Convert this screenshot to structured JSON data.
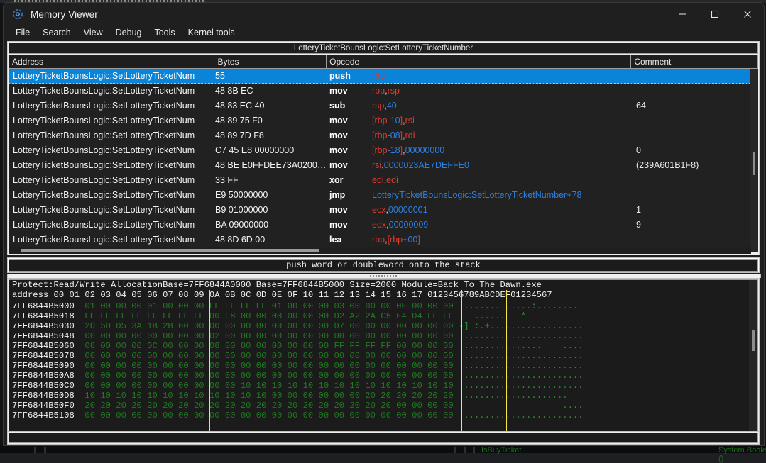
{
  "window": {
    "title": "Memory Viewer",
    "icon": "cheat-engine-icon",
    "controls": {
      "minimize": "—",
      "maximize": "☐",
      "close": "✕"
    }
  },
  "menubar": {
    "items": [
      "File",
      "Search",
      "View",
      "Debug",
      "Tools",
      "Kernel tools"
    ]
  },
  "disassembler": {
    "function_header": "LotteryTicketBounsLogic:SetLotteryTicketNumber",
    "columns": [
      "Address",
      "Bytes",
      "Opcode",
      "Comment"
    ],
    "rows": [
      {
        "address": "LotteryTicketBounsLogic:SetLotteryTicketNum",
        "bytes": "55",
        "mnemonic": "push",
        "operands": "rbp",
        "comment": "",
        "selected": true
      },
      {
        "address": "LotteryTicketBounsLogic:SetLotteryTicketNum",
        "bytes": "48 8B EC",
        "mnemonic": "mov",
        "operands": "rbp,rsp",
        "comment": "",
        "selected": false
      },
      {
        "address": "LotteryTicketBounsLogic:SetLotteryTicketNum",
        "bytes": "48 83 EC 40",
        "mnemonic": "sub",
        "operands": "rsp,40",
        "comment": "64",
        "selected": false
      },
      {
        "address": "LotteryTicketBounsLogic:SetLotteryTicketNum",
        "bytes": "48 89 75 F0",
        "mnemonic": "mov",
        "operands": "[rbp-10],rsi",
        "comment": "",
        "selected": false
      },
      {
        "address": "LotteryTicketBounsLogic:SetLotteryTicketNum",
        "bytes": "48 89 7D F8",
        "mnemonic": "mov",
        "operands": "[rbp-08],rdi",
        "comment": "",
        "selected": false
      },
      {
        "address": "LotteryTicketBounsLogic:SetLotteryTicketNum",
        "bytes": "C7 45 E8 00000000",
        "mnemonic": "mov",
        "operands": "[rbp-18],00000000",
        "comment": "0",
        "selected": false
      },
      {
        "address": "LotteryTicketBounsLogic:SetLotteryTicketNum",
        "bytes": "48 BE E0FFDEE73A0200…",
        "mnemonic": "mov",
        "operands": "rsi,0000023AE7DEFFE0",
        "comment": "(239A601B1F8)",
        "selected": false
      },
      {
        "address": "LotteryTicketBounsLogic:SetLotteryTicketNum",
        "bytes": "33 FF",
        "mnemonic": "xor",
        "operands": "edi,edi",
        "comment": "",
        "selected": false
      },
      {
        "address": "LotteryTicketBounsLogic:SetLotteryTicketNum",
        "bytes": "E9 50000000",
        "mnemonic": "jmp",
        "operands": "LotteryTicketBounsLogic:SetLotteryTicketNumber+78",
        "comment": "",
        "selected": false
      },
      {
        "address": "LotteryTicketBounsLogic:SetLotteryTicketNum",
        "bytes": "B9 01000000",
        "mnemonic": "mov",
        "operands": "ecx,00000001",
        "comment": "1",
        "selected": false
      },
      {
        "address": "LotteryTicketBounsLogic:SetLotteryTicketNum",
        "bytes": "BA 09000000",
        "mnemonic": "mov",
        "operands": "edx,00000009",
        "comment": "9",
        "selected": false
      },
      {
        "address": "LotteryTicketBounsLogic:SetLotteryTicketNum",
        "bytes": "48 8D 6D 00",
        "mnemonic": "lea",
        "operands": "rbp,[rbp+00]",
        "comment": "",
        "selected": false
      }
    ]
  },
  "hint_bar": {
    "text": "push word or doubleword onto the stack"
  },
  "hexview": {
    "info": "Protect:Read/Write  AllocationBase=7FF6844A0000 Base=7FF6844B5000 Size=2000 Module=Back To The Dawn.exe",
    "column_header": "address      00 01 02 03 04 05 06 07 08 09 0A 0B 0C 0D 0E 0F 10 11 12 13 14 15 16 17 0123456789ABCDEF01234567",
    "rows": [
      {
        "address": "7FF6844B5000",
        "bytes": "01 00 00 00 01 00 00 00 FF FF FF FF 01 00 00 00 03 00 00 00 0E 00 00 00",
        "ascii": "........ .....:........"
      },
      {
        "address": "7FF6844B5018",
        "bytes": "FF FF FF FF FF FF FF FF 00 F8 00 00 00 00 00 00 D2 A2 2A C5 E4 D4 FF FF",
        "ascii": ".  ......   *"
      },
      {
        "address": "7FF6844B5030",
        "bytes": "2D 5D D5 3A 1B 2B 00 00 00 00 00 00 00 00 00 00 07 00 00 00 00 00 00 00",
        "ascii": "-] :.+.................."
      },
      {
        "address": "7FF6844B5048",
        "bytes": "00 00 00 00 00 00 00 00 02 00 00 00 00 00 00 00 00 00 00 00 00 00 00 00",
        "ascii": "........................"
      },
      {
        "address": "7FF6844B5060",
        "bytes": "08 00 00 00 0C 00 00 00 08 00 00 00 00 00 00 00 FF FF FF FF 00 00 00 00",
        "ascii": "................    ...."
      },
      {
        "address": "7FF6844B5078",
        "bytes": "00 00 00 00 00 00 00 00 00 00 00 00 00 00 00 00 00 00 00 00 00 00 00 00",
        "ascii": "........................"
      },
      {
        "address": "7FF6844B5090",
        "bytes": "00 00 00 00 00 00 00 00 00 00 00 00 00 00 00 00 00 00 00 00 00 00 00 00",
        "ascii": "........................"
      },
      {
        "address": "7FF6844B50A8",
        "bytes": "00 00 00 00 00 00 00 00 00 00 00 00 00 00 00 00 00 00 00 00 00 00 00 00",
        "ascii": "........................"
      },
      {
        "address": "7FF6844B50C0",
        "bytes": "00 00 00 00 00 00 00 00 00 00 10 10 10 10 10 10 10 10 10 10 10 10 10 10",
        "ascii": "........................"
      },
      {
        "address": "7FF6844B50D8",
        "bytes": "10 10 10 10 10 10 10 10 10 10 10 10 00 00 00 00 00 00 20 20 20 20 20 20",
        "ascii": "....................."
      },
      {
        "address": "7FF6844B50F0",
        "bytes": "20 20 20 20 20 20 20 20 20 20 20 20 20 20 20 20 20 20 20 20 00 00 00 00",
        "ascii": "                    ...."
      },
      {
        "address": "7FF6844B5108",
        "bytes": "00 00 00 00 00 00 00 00 00 00 00 00 00 00 00 00 00 00 00 00 00 00 00 00",
        "ascii": "........................"
      }
    ]
  },
  "background_window": {
    "label_left": "IsBuyTicket",
    "label_right": "System.Boolean ()"
  },
  "colors": {
    "selection": "#0a84d8",
    "register": "#e03b2f",
    "value": "#2f7fe0",
    "hex_bytes": "#1f7a1f",
    "separator": "#f5e642",
    "window_bg": "#1f1f1f"
  }
}
